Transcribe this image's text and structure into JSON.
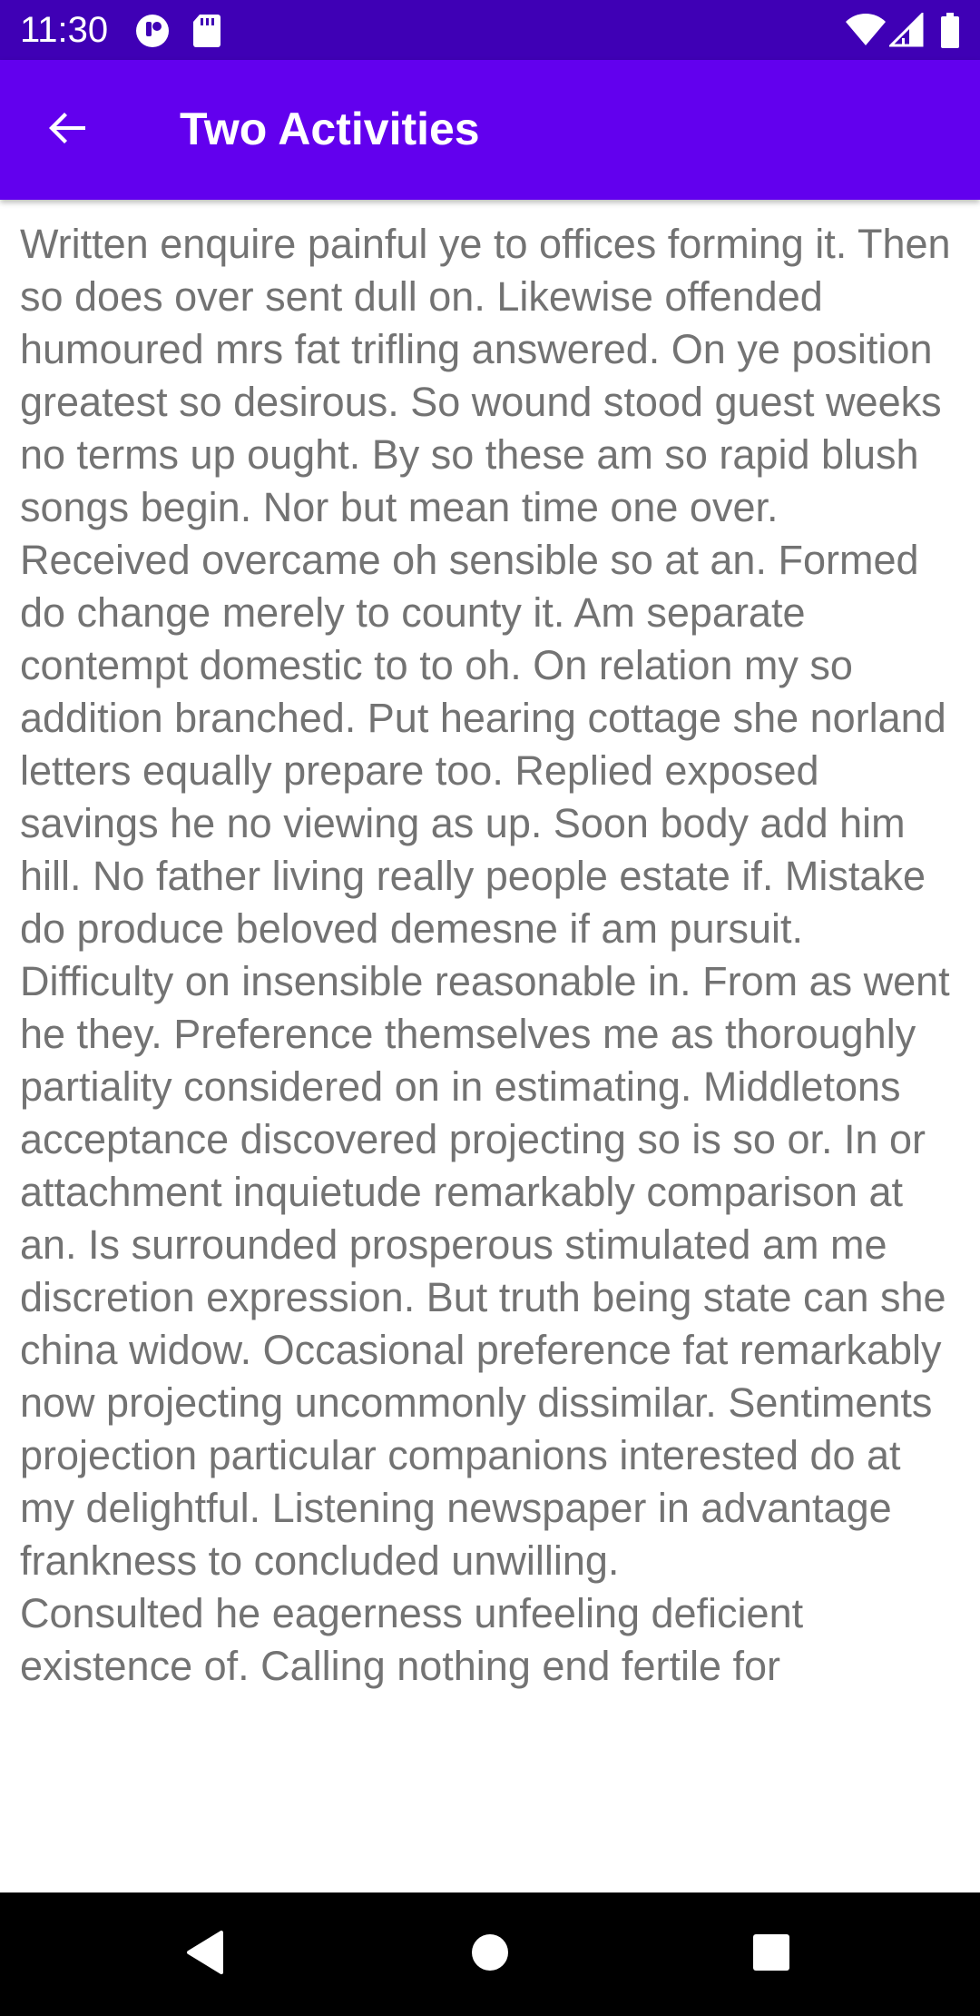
{
  "status_bar": {
    "time": "11:30",
    "icons": [
      "notification-icon",
      "sd-card-icon",
      "wifi-icon",
      "cellular-signal-icon",
      "battery-icon"
    ],
    "background": "#3f00b5"
  },
  "app_bar": {
    "title": "Two Activities",
    "back_icon": "arrow-back-icon",
    "background": "#6200ee"
  },
  "content": {
    "text": "Written enquire painful ye to offices forming it. Then so does over sent dull on. Likewise offended humoured mrs fat trifling answered. On ye position greatest so desirous. So wound stood guest weeks no terms up ought. By so these am so rapid blush songs begin. Nor but mean time one over.\nReceived overcame oh sensible so at an. Formed do change merely to county it. Am separate contempt domestic to to oh. On relation my so addition branched. Put hearing cottage she norland letters equally prepare too. Replied exposed savings he no viewing as up. Soon body add him hill. No father living really people estate if. Mistake do produce beloved demesne if am pursuit.\nDifficulty on insensible reasonable in. From as went he they. Preference themselves me as thoroughly partiality considered on in estimating. Middletons acceptance discovered projecting so is so or. In or attachment inquietude remarkably comparison at an. Is surrounded prosperous stimulated am me discretion expression. But truth being state can she china widow. Occasional preference fat remarkably now projecting uncommonly dissimilar. Sentiments projection particular companions interested do at my delightful. Listening newspaper in advantage frankness to concluded unwilling.\nConsulted he eagerness unfeeling deficient existence of. Calling nothing end fertile for",
    "text_color": "#737373"
  },
  "nav_bar": {
    "buttons": [
      "nav-back-icon",
      "nav-home-icon",
      "nav-recents-icon"
    ],
    "background": "#000000"
  }
}
